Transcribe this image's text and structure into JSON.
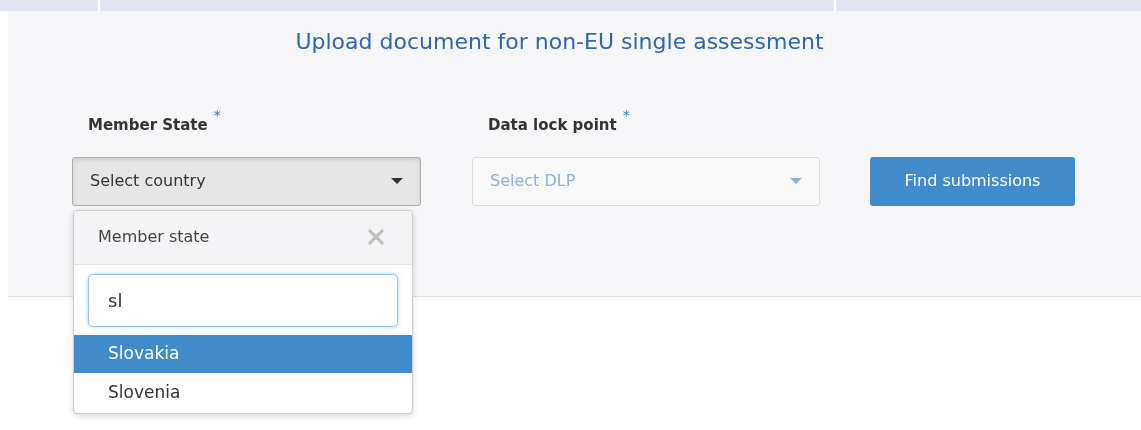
{
  "title": "Upload document for non-EU single assessment",
  "fields": [
    {
      "label": "Member State",
      "required_mark": "*",
      "placeholder": "Select country",
      "active": true
    },
    {
      "label": "Data lock point",
      "required_mark": "*",
      "placeholder": "Select DLP",
      "active": false
    }
  ],
  "button": "Find submissions",
  "dropdown": {
    "header": "Member state",
    "search_value": "sl",
    "options": [
      {
        "label": "Slovakia",
        "selected": true
      },
      {
        "label": "Slovenia",
        "selected": false
      }
    ]
  }
}
